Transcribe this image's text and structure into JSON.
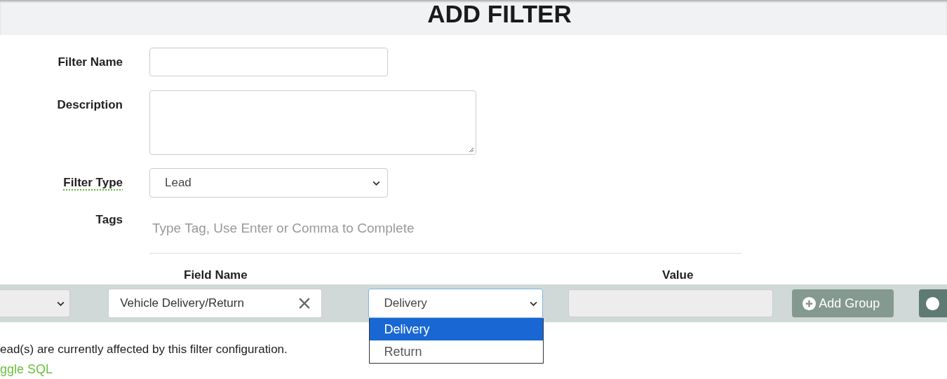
{
  "title": "ADD FILTER",
  "form": [
    {
      "kind": "text",
      "label": "Filter Name",
      "spellcheck_flagged": false
    },
    {
      "kind": "textarea",
      "label": "Description",
      "spellcheck_flagged": false
    },
    {
      "kind": "select",
      "label": "Filter Type",
      "value": "Lead",
      "spellcheck_flagged": true
    },
    {
      "kind": "tags",
      "label": "Tags",
      "placeholder": "Type Tag, Use Enter or Comma to Complete",
      "spellcheck_flagged": false
    }
  ],
  "column_headers": [
    "Field Name",
    "Value"
  ],
  "condition_row": {
    "field": "Vehicle Delivery/Return",
    "operator": "Delivery",
    "options": [
      {
        "label": "Delivery",
        "selected": true
      },
      {
        "label": "Return",
        "selected": false
      }
    ],
    "add_group": "Add Group"
  },
  "affected_text": "ead(s) are currently affected by this filter configuration.",
  "toggle_link": "ggle SQL"
}
